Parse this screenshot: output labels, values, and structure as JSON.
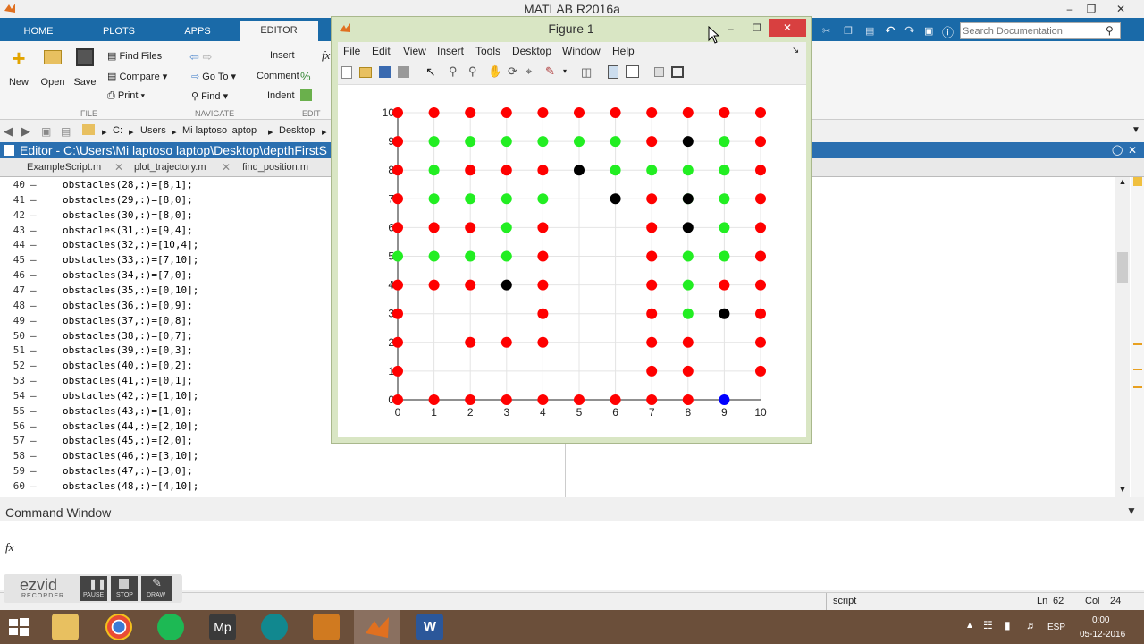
{
  "app": {
    "title": "MATLAB R2016a"
  },
  "ribbon": {
    "tabs": [
      "HOME",
      "PLOTS",
      "APPS",
      "EDITOR"
    ],
    "new": "New",
    "open": "Open",
    "save": "Save",
    "find_files": "Find Files",
    "compare": "Compare",
    "print": "Print",
    "goto": "Go To",
    "find": "Find",
    "insert": "Insert",
    "comment": "Comment",
    "indent": "Indent",
    "fx": "fx",
    "sections": {
      "file": "FILE",
      "navigate": "NAVIGATE",
      "edit": "EDIT"
    },
    "search_placeholder": "Search Documentation"
  },
  "path": {
    "items": [
      "C:",
      "Users",
      "Mi laptoso laptop",
      "Desktop"
    ]
  },
  "editor": {
    "title": "Editor - C:\\Users\\Mi laptoso laptop\\Desktop\\depthFirstS",
    "tabs": [
      "ExampleScript.m",
      "plot_trajectory.m",
      "find_position.m"
    ],
    "lines": [
      {
        "n": "40",
        "code": "obstacles(28,:)=[8,1];"
      },
      {
        "n": "41",
        "code": "obstacles(29,:)=[8,0];"
      },
      {
        "n": "42",
        "code": "obstacles(30,:)=[8,0];"
      },
      {
        "n": "43",
        "code": "obstacles(31,:)=[9,4];"
      },
      {
        "n": "44",
        "code": "obstacles(32,:)=[10,4];"
      },
      {
        "n": "45",
        "code": "obstacles(33,:)=[7,10];"
      },
      {
        "n": "46",
        "code": "obstacles(34,:)=[7,0];"
      },
      {
        "n": "47",
        "code": "obstacles(35,:)=[0,10];"
      },
      {
        "n": "48",
        "code": "obstacles(36,:)=[0,9];"
      },
      {
        "n": "49",
        "code": "obstacles(37,:)=[0,8];"
      },
      {
        "n": "50",
        "code": "obstacles(38,:)=[0,7];"
      },
      {
        "n": "51",
        "code": "obstacles(39,:)=[0,3];"
      },
      {
        "n": "52",
        "code": "obstacles(40,:)=[0,2];"
      },
      {
        "n": "53",
        "code": "obstacles(41,:)=[0,1];"
      },
      {
        "n": "54",
        "code": "obstacles(42,:)=[1,10];"
      },
      {
        "n": "55",
        "code": "obstacles(43,:)=[1,0];"
      },
      {
        "n": "56",
        "code": "obstacles(44,:)=[2,10];"
      },
      {
        "n": "57",
        "code": "obstacles(45,:)=[2,0];"
      },
      {
        "n": "58",
        "code": "obstacles(46,:)=[3,10];"
      },
      {
        "n": "59",
        "code": "obstacles(47,:)=[3,0];"
      },
      {
        "n": "60",
        "code": "obstacles(48,:)=[4,10];"
      }
    ]
  },
  "command": {
    "title": "Command Window",
    "prompt": "fx"
  },
  "status": {
    "mode": "script",
    "ln_label": "Ln",
    "ln": "62",
    "col_label": "Col",
    "col": "24"
  },
  "ezvid": {
    "brand": "ezvid",
    "sub": "RECORDER",
    "pause": "PAUSE",
    "stop": "STOP",
    "draw": "DRAW"
  },
  "taskbar": {
    "lang": "ESP",
    "time": "0:00",
    "date": "05-12-2016"
  },
  "figure": {
    "title": "Figure 1",
    "menu": [
      "File",
      "Edit",
      "View",
      "Insert",
      "Tools",
      "Desktop",
      "Window",
      "Help"
    ]
  },
  "colors": {
    "red": "#ff0000",
    "green": "#22ee22",
    "black": "#000000",
    "blue": "#0000ff"
  },
  "chart_data": {
    "type": "scatter",
    "xlim": [
      0,
      10
    ],
    "ylim": [
      0,
      10
    ],
    "xticks": [
      "0",
      "1",
      "2",
      "3",
      "4",
      "5",
      "6",
      "7",
      "8",
      "9",
      "10"
    ],
    "yticks": [
      "0",
      "1",
      "2",
      "3",
      "4",
      "5",
      "6",
      "7",
      "8",
      "9",
      "10"
    ],
    "grid": true,
    "series": [
      {
        "color": "red",
        "points": [
          [
            0,
            10
          ],
          [
            1,
            10
          ],
          [
            2,
            10
          ],
          [
            3,
            10
          ],
          [
            4,
            10
          ],
          [
            5,
            10
          ],
          [
            6,
            10
          ],
          [
            7,
            10
          ],
          [
            8,
            10
          ],
          [
            9,
            10
          ],
          [
            10,
            10
          ],
          [
            0,
            9
          ],
          [
            7,
            9
          ],
          [
            10,
            9
          ],
          [
            0,
            8
          ],
          [
            2,
            8
          ],
          [
            3,
            8
          ],
          [
            4,
            8
          ],
          [
            10,
            8
          ],
          [
            0,
            7
          ],
          [
            7,
            7
          ],
          [
            10,
            7
          ],
          [
            0,
            6
          ],
          [
            1,
            6
          ],
          [
            2,
            6
          ],
          [
            4,
            6
          ],
          [
            7,
            6
          ],
          [
            10,
            6
          ],
          [
            4,
            5
          ],
          [
            7,
            5
          ],
          [
            10,
            5
          ],
          [
            0,
            4
          ],
          [
            1,
            4
          ],
          [
            2,
            4
          ],
          [
            4,
            4
          ],
          [
            7,
            4
          ],
          [
            9,
            4
          ],
          [
            10,
            4
          ],
          [
            0,
            3
          ],
          [
            4,
            3
          ],
          [
            7,
            3
          ],
          [
            10,
            3
          ],
          [
            0,
            2
          ],
          [
            2,
            2
          ],
          [
            3,
            2
          ],
          [
            4,
            2
          ],
          [
            7,
            2
          ],
          [
            8,
            2
          ],
          [
            10,
            2
          ],
          [
            0,
            1
          ],
          [
            7,
            1
          ],
          [
            8,
            1
          ],
          [
            10,
            1
          ],
          [
            0,
            0
          ],
          [
            1,
            0
          ],
          [
            2,
            0
          ],
          [
            3,
            0
          ],
          [
            4,
            0
          ],
          [
            5,
            0
          ],
          [
            6,
            0
          ],
          [
            7,
            0
          ],
          [
            8,
            0
          ]
        ]
      },
      {
        "color": "green",
        "points": [
          [
            1,
            9
          ],
          [
            2,
            9
          ],
          [
            3,
            9
          ],
          [
            4,
            9
          ],
          [
            5,
            9
          ],
          [
            6,
            9
          ],
          [
            9,
            9
          ],
          [
            1,
            8
          ],
          [
            6,
            8
          ],
          [
            7,
            8
          ],
          [
            8,
            8
          ],
          [
            9,
            8
          ],
          [
            1,
            7
          ],
          [
            2,
            7
          ],
          [
            3,
            7
          ],
          [
            4,
            7
          ],
          [
            8,
            7
          ],
          [
            9,
            7
          ],
          [
            3,
            6
          ],
          [
            9,
            6
          ],
          [
            0,
            5
          ],
          [
            1,
            5
          ],
          [
            2,
            5
          ],
          [
            3,
            5
          ],
          [
            8,
            5
          ],
          [
            9,
            5
          ],
          [
            8,
            4
          ],
          [
            8,
            3
          ]
        ]
      },
      {
        "color": "black",
        "points": [
          [
            8,
            9
          ],
          [
            5,
            8
          ],
          [
            6,
            7
          ],
          [
            8,
            7
          ],
          [
            8,
            6
          ],
          [
            3,
            4
          ],
          [
            9,
            3
          ]
        ]
      },
      {
        "color": "blue",
        "points": [
          [
            9,
            0
          ]
        ]
      }
    ]
  }
}
